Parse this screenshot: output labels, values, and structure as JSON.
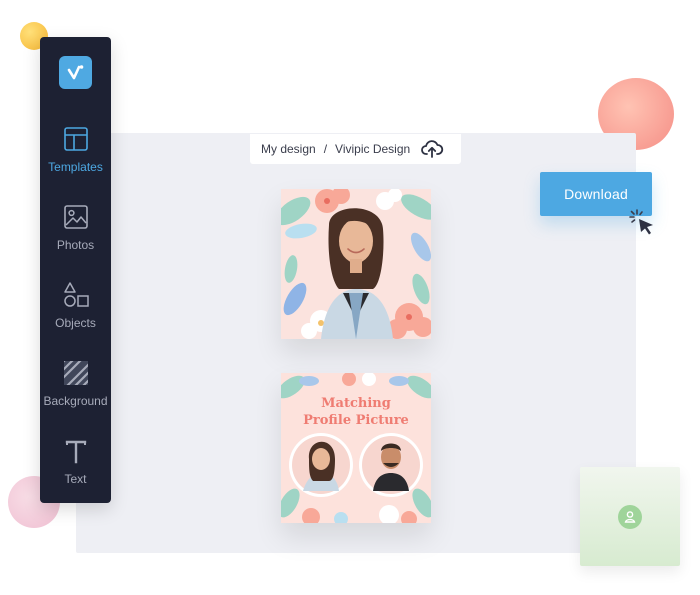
{
  "sidebar": {
    "logo": "vivipic-logo",
    "items": [
      {
        "label": "Templates",
        "icon": "templates-icon",
        "active": true
      },
      {
        "label": "Photos",
        "icon": "photos-icon",
        "active": false
      },
      {
        "label": "Objects",
        "icon": "objects-icon",
        "active": false
      },
      {
        "label": "Background",
        "icon": "background-icon",
        "active": false
      },
      {
        "label": "Text",
        "icon": "text-icon",
        "active": false
      }
    ]
  },
  "breadcrumb": {
    "root": "My design",
    "separator": "/",
    "current": "Vivipic Design",
    "icon": "cloud-upload-icon"
  },
  "actions": {
    "download_label": "Download"
  },
  "design_cards": [
    {
      "type": "profile-photo",
      "style": "tropical floral frame"
    },
    {
      "type": "matching-profile",
      "heading_line1": "Matching",
      "heading_line2": "Profile Picture"
    }
  ],
  "colors": {
    "sidebar_bg": "#1d2133",
    "accent": "#4da8e2",
    "canvas_bg": "#eeeff4",
    "card_bg": "#fbe3de",
    "heading_coral": "#ef7c72"
  }
}
